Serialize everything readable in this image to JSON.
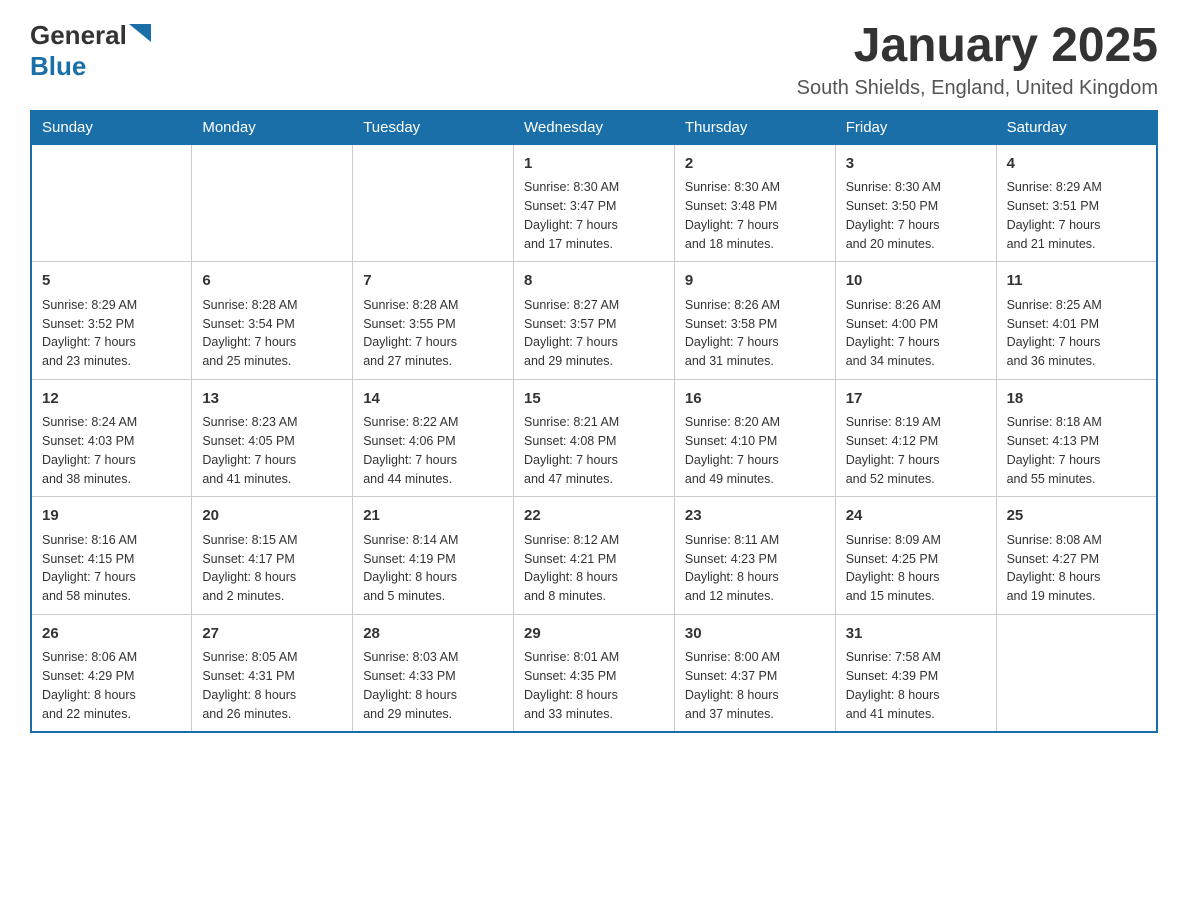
{
  "header": {
    "logo_general": "General",
    "logo_blue": "Blue",
    "month_title": "January 2025",
    "location": "South Shields, England, United Kingdom"
  },
  "weekdays": [
    "Sunday",
    "Monday",
    "Tuesday",
    "Wednesday",
    "Thursday",
    "Friday",
    "Saturday"
  ],
  "weeks": [
    [
      {
        "day": "",
        "info": ""
      },
      {
        "day": "",
        "info": ""
      },
      {
        "day": "",
        "info": ""
      },
      {
        "day": "1",
        "info": "Sunrise: 8:30 AM\nSunset: 3:47 PM\nDaylight: 7 hours\nand 17 minutes."
      },
      {
        "day": "2",
        "info": "Sunrise: 8:30 AM\nSunset: 3:48 PM\nDaylight: 7 hours\nand 18 minutes."
      },
      {
        "day": "3",
        "info": "Sunrise: 8:30 AM\nSunset: 3:50 PM\nDaylight: 7 hours\nand 20 minutes."
      },
      {
        "day": "4",
        "info": "Sunrise: 8:29 AM\nSunset: 3:51 PM\nDaylight: 7 hours\nand 21 minutes."
      }
    ],
    [
      {
        "day": "5",
        "info": "Sunrise: 8:29 AM\nSunset: 3:52 PM\nDaylight: 7 hours\nand 23 minutes."
      },
      {
        "day": "6",
        "info": "Sunrise: 8:28 AM\nSunset: 3:54 PM\nDaylight: 7 hours\nand 25 minutes."
      },
      {
        "day": "7",
        "info": "Sunrise: 8:28 AM\nSunset: 3:55 PM\nDaylight: 7 hours\nand 27 minutes."
      },
      {
        "day": "8",
        "info": "Sunrise: 8:27 AM\nSunset: 3:57 PM\nDaylight: 7 hours\nand 29 minutes."
      },
      {
        "day": "9",
        "info": "Sunrise: 8:26 AM\nSunset: 3:58 PM\nDaylight: 7 hours\nand 31 minutes."
      },
      {
        "day": "10",
        "info": "Sunrise: 8:26 AM\nSunset: 4:00 PM\nDaylight: 7 hours\nand 34 minutes."
      },
      {
        "day": "11",
        "info": "Sunrise: 8:25 AM\nSunset: 4:01 PM\nDaylight: 7 hours\nand 36 minutes."
      }
    ],
    [
      {
        "day": "12",
        "info": "Sunrise: 8:24 AM\nSunset: 4:03 PM\nDaylight: 7 hours\nand 38 minutes."
      },
      {
        "day": "13",
        "info": "Sunrise: 8:23 AM\nSunset: 4:05 PM\nDaylight: 7 hours\nand 41 minutes."
      },
      {
        "day": "14",
        "info": "Sunrise: 8:22 AM\nSunset: 4:06 PM\nDaylight: 7 hours\nand 44 minutes."
      },
      {
        "day": "15",
        "info": "Sunrise: 8:21 AM\nSunset: 4:08 PM\nDaylight: 7 hours\nand 47 minutes."
      },
      {
        "day": "16",
        "info": "Sunrise: 8:20 AM\nSunset: 4:10 PM\nDaylight: 7 hours\nand 49 minutes."
      },
      {
        "day": "17",
        "info": "Sunrise: 8:19 AM\nSunset: 4:12 PM\nDaylight: 7 hours\nand 52 minutes."
      },
      {
        "day": "18",
        "info": "Sunrise: 8:18 AM\nSunset: 4:13 PM\nDaylight: 7 hours\nand 55 minutes."
      }
    ],
    [
      {
        "day": "19",
        "info": "Sunrise: 8:16 AM\nSunset: 4:15 PM\nDaylight: 7 hours\nand 58 minutes."
      },
      {
        "day": "20",
        "info": "Sunrise: 8:15 AM\nSunset: 4:17 PM\nDaylight: 8 hours\nand 2 minutes."
      },
      {
        "day": "21",
        "info": "Sunrise: 8:14 AM\nSunset: 4:19 PM\nDaylight: 8 hours\nand 5 minutes."
      },
      {
        "day": "22",
        "info": "Sunrise: 8:12 AM\nSunset: 4:21 PM\nDaylight: 8 hours\nand 8 minutes."
      },
      {
        "day": "23",
        "info": "Sunrise: 8:11 AM\nSunset: 4:23 PM\nDaylight: 8 hours\nand 12 minutes."
      },
      {
        "day": "24",
        "info": "Sunrise: 8:09 AM\nSunset: 4:25 PM\nDaylight: 8 hours\nand 15 minutes."
      },
      {
        "day": "25",
        "info": "Sunrise: 8:08 AM\nSunset: 4:27 PM\nDaylight: 8 hours\nand 19 minutes."
      }
    ],
    [
      {
        "day": "26",
        "info": "Sunrise: 8:06 AM\nSunset: 4:29 PM\nDaylight: 8 hours\nand 22 minutes."
      },
      {
        "day": "27",
        "info": "Sunrise: 8:05 AM\nSunset: 4:31 PM\nDaylight: 8 hours\nand 26 minutes."
      },
      {
        "day": "28",
        "info": "Sunrise: 8:03 AM\nSunset: 4:33 PM\nDaylight: 8 hours\nand 29 minutes."
      },
      {
        "day": "29",
        "info": "Sunrise: 8:01 AM\nSunset: 4:35 PM\nDaylight: 8 hours\nand 33 minutes."
      },
      {
        "day": "30",
        "info": "Sunrise: 8:00 AM\nSunset: 4:37 PM\nDaylight: 8 hours\nand 37 minutes."
      },
      {
        "day": "31",
        "info": "Sunrise: 7:58 AM\nSunset: 4:39 PM\nDaylight: 8 hours\nand 41 minutes."
      },
      {
        "day": "",
        "info": ""
      }
    ]
  ]
}
